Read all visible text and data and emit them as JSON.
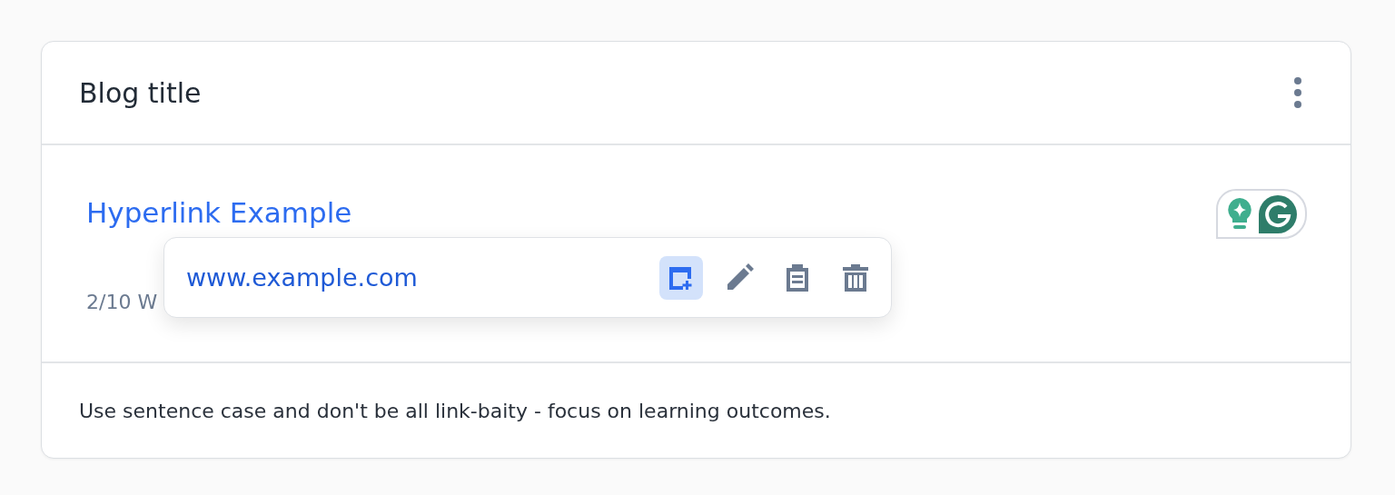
{
  "card": {
    "title": "Blog title",
    "link_text": "Hyperlink Example",
    "counter": "2/10 W",
    "hint": "Use sentence case and don't be all link-baity - focus on learning outcomes."
  },
  "link_popup": {
    "url": "www.example.com",
    "actions": [
      {
        "kind": "open",
        "selected": true
      },
      {
        "kind": "edit",
        "selected": false
      },
      {
        "kind": "copy",
        "selected": false
      },
      {
        "kind": "delete",
        "selected": false
      }
    ]
  }
}
